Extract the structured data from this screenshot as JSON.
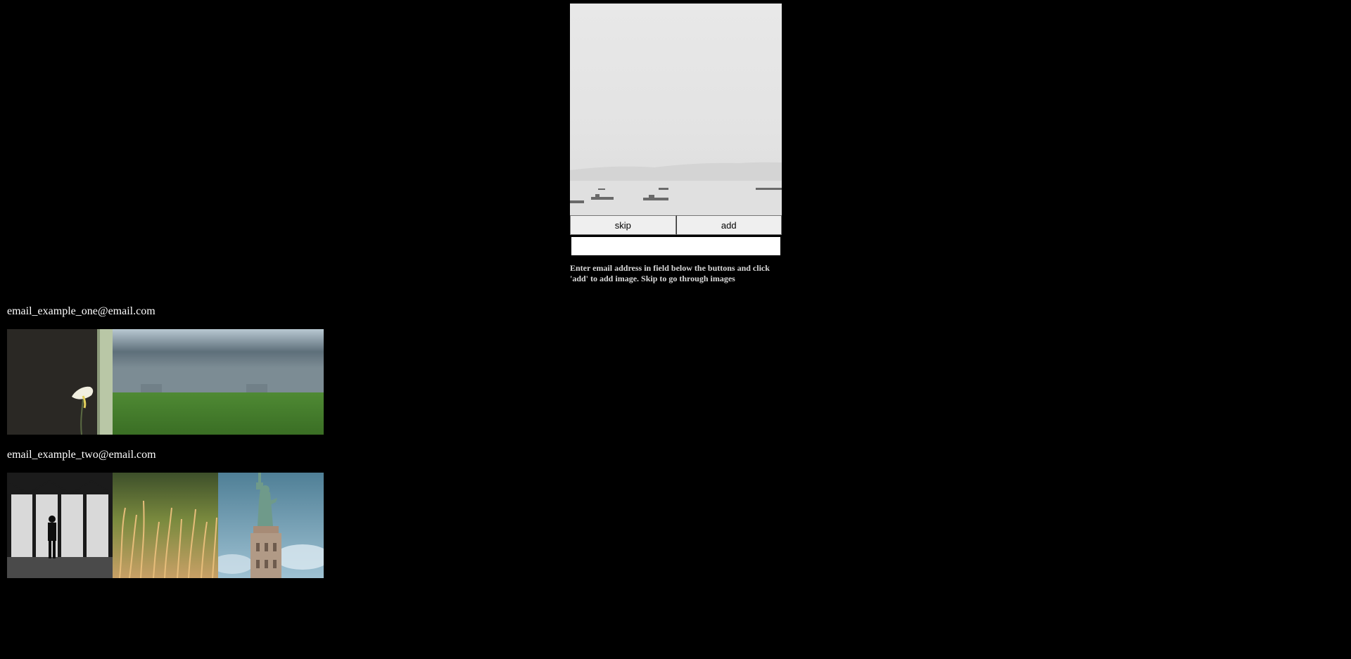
{
  "picker": {
    "preview_image": "misty-harbor-with-boats",
    "skip_label": "skip",
    "add_label": "add",
    "email_value": "",
    "instructions": "Enter email address in field below the buttons and click 'add' to add image. Skip to go through images"
  },
  "groups": [
    {
      "email": "email_example_one@email.com",
      "images": [
        "calla-lily-by-wall",
        "storm-clouds-over-field",
        "storm-clouds-over-field"
      ]
    },
    {
      "email": "email_example_two@email.com",
      "images": [
        "silhouette-in-hangar",
        "golden-grass-close-up",
        "statue-of-liberty"
      ]
    }
  ]
}
